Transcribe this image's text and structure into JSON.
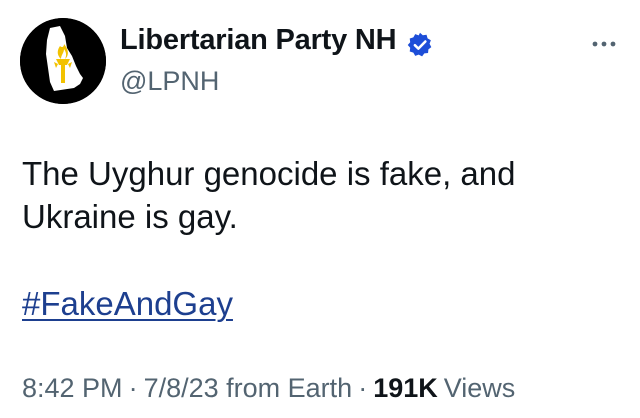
{
  "tweet": {
    "author": {
      "display_name": "Libertarian Party NH",
      "handle": "@LPNH",
      "verified_icon": "verified-badge-icon",
      "avatar_icon": "new-hampshire-torch-logo"
    },
    "more_icon": "more-horizontal-icon",
    "text_lines": [
      "The Uyghur genocide is fake, and",
      "Ukraine is gay."
    ],
    "hashtag": "#FakeAndGay",
    "meta": {
      "time": "8:42 PM",
      "separator": "·",
      "date": "7/8/23",
      "source": "from Earth",
      "views_count": "191K",
      "views_label": "Views"
    },
    "colors": {
      "text": "#0f1419",
      "secondary": "#536471",
      "link": "#1d3f8f",
      "verified": "#1d4ed8",
      "avatar_bg": "#000000",
      "torch": "#f2c200"
    }
  }
}
